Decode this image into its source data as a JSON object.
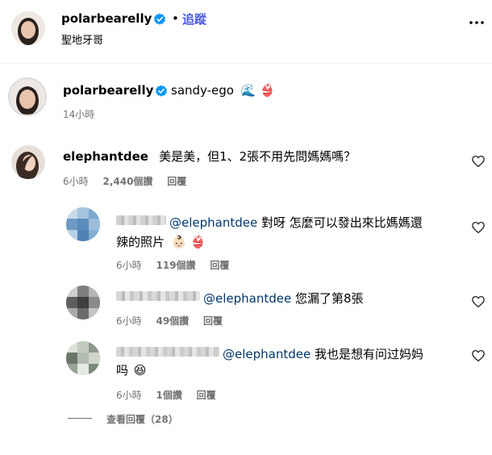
{
  "header": {
    "username": "polarbearelly",
    "dot": "•",
    "follow_label": "追蹤",
    "location": "聖地牙哥",
    "more_icon": "more-horizontal-icon"
  },
  "caption": {
    "username": "polarbearelly",
    "text": "sandy-ego",
    "emoji_wave": "🌊",
    "emoji_bikini": "👙",
    "time": "14小時"
  },
  "comment": {
    "username": "elephantdee",
    "text": "美是美，但1、2張不用先問媽媽嗎？",
    "time": "6小時",
    "likes": "2,440個讚",
    "reply_label": "回覆"
  },
  "replies": [
    {
      "mention": "@elephantdee",
      "text_line1": " 對呀 怎麼可以發出來比媽媽還",
      "text_line2": "辣的照片",
      "emoji1": "👶🏻",
      "emoji2": "👙",
      "time": "6小時",
      "likes": "119個讚",
      "reply_label": "回覆"
    },
    {
      "mention": "@elephantdee",
      "text_line1": " 您漏了第8張",
      "time": "6小時",
      "likes": "49個讚",
      "reply_label": "回覆"
    },
    {
      "mention": "@elephantdee",
      "text_line1": " 我也是想有问过妈妈",
      "text_line2": "吗",
      "emoji1": "😆",
      "time": "6小時",
      "likes": "1個讚",
      "reply_label": "回覆"
    }
  ],
  "view_replies": "查看回覆（28）",
  "colors": {
    "verified": "#0095f6",
    "follow": "#0095f6",
    "mention": "#00376b",
    "meta": "#737373"
  }
}
